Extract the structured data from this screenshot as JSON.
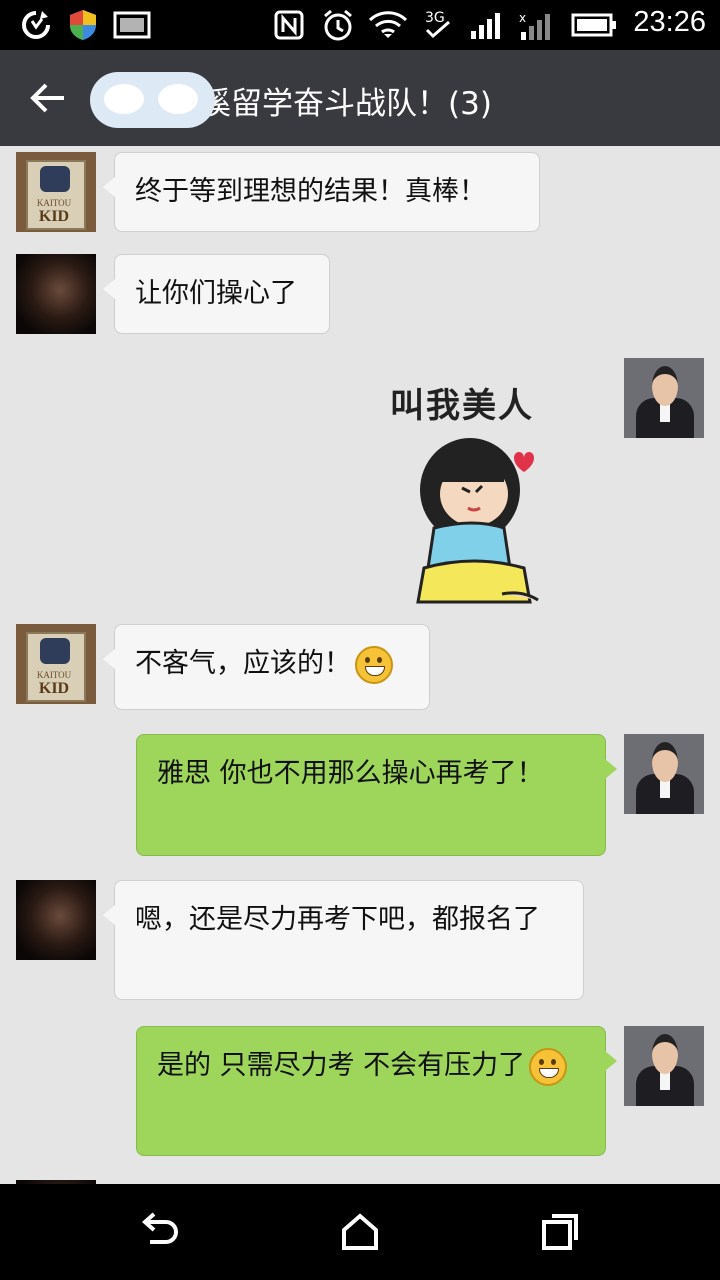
{
  "status_bar": {
    "time": "23:26",
    "icons": [
      "sync-icon",
      "shield-icon",
      "gallery-icon",
      "nfc-icon",
      "alarm-icon",
      "wifi-icon",
      "3g-icon",
      "signal-icon",
      "signal-roaming-icon",
      "battery-icon"
    ]
  },
  "header": {
    "title": "溪留学奋斗战队！(3)"
  },
  "messages": [
    {
      "side": "in",
      "sender": "kaitou-kid",
      "text": "终于等到理想的结果！真棒！"
    },
    {
      "side": "in",
      "sender": "dark-avatar",
      "text": "让你们操心了"
    },
    {
      "side": "out",
      "sender": "advisor",
      "type": "sticker",
      "text": "叫我美人"
    },
    {
      "side": "in",
      "sender": "kaitou-kid",
      "text": "不客气，应该的！",
      "emoji": "grin-emoji"
    },
    {
      "side": "out",
      "sender": "advisor",
      "text": "雅思  你也不用那么操心再考了！"
    },
    {
      "side": "in",
      "sender": "dark-avatar",
      "text": "嗯，还是尽力再考下吧，都报名了"
    },
    {
      "side": "out",
      "sender": "advisor",
      "text": "是的 只需尽力考  不会有压力了",
      "emoji": "grimace-emoji"
    }
  ],
  "avatars": {
    "kaitou_kid_line1": "KAITOU",
    "kaitou_kid_line2": "KID"
  },
  "nav_bar": {
    "buttons": [
      "back-nav-icon",
      "home-icon",
      "recents-icon"
    ]
  },
  "colors": {
    "status_bar": "#000000",
    "title_bar": "#393a3f",
    "chat_bg": "#e5e5e5",
    "incoming_bubble": "#f6f6f6",
    "outgoing_bubble": "#9ed65c"
  }
}
